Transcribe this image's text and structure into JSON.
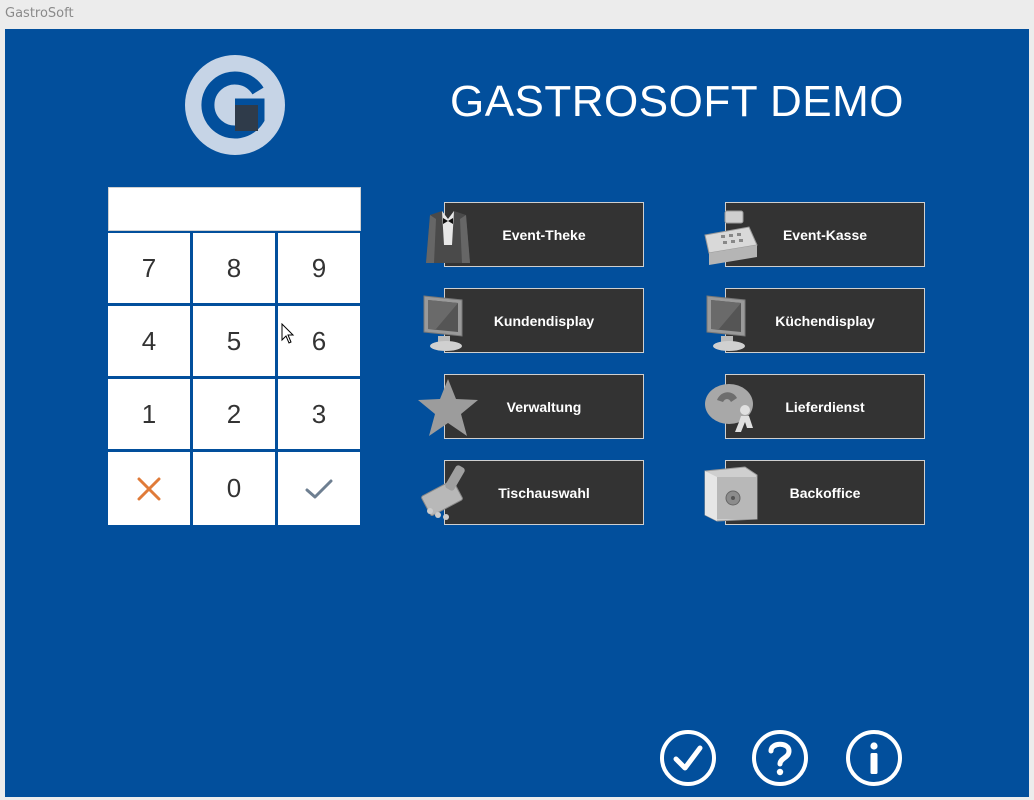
{
  "window": {
    "title": "GastroSoft"
  },
  "header": {
    "title": "GASTROSOFT DEMO"
  },
  "pin": {
    "value": ""
  },
  "keypad": {
    "keys": [
      {
        "label": "7"
      },
      {
        "label": "8"
      },
      {
        "label": "9"
      },
      {
        "label": "4"
      },
      {
        "label": "5"
      },
      {
        "label": "6"
      },
      {
        "label": "1"
      },
      {
        "label": "2"
      },
      {
        "label": "3"
      },
      {
        "icon": "cancel-icon"
      },
      {
        "label": "0"
      },
      {
        "icon": "confirm-icon"
      }
    ]
  },
  "functions": [
    {
      "label": "Event-Theke",
      "icon": "waiter-icon"
    },
    {
      "label": "Event-Kasse",
      "icon": "cash-register-icon"
    },
    {
      "label": "Kundendisplay",
      "icon": "monitor-icon"
    },
    {
      "label": "Küchendisplay",
      "icon": "monitor-icon"
    },
    {
      "label": "Verwaltung",
      "icon": "star-icon"
    },
    {
      "label": "Lieferdienst",
      "icon": "delivery-icon"
    },
    {
      "label": "Tischauswahl",
      "icon": "table-select-icon"
    },
    {
      "label": "Backoffice",
      "icon": "safe-icon"
    }
  ],
  "footer": {
    "buttons": [
      {
        "icon": "check-circle-icon"
      },
      {
        "icon": "help-circle-icon"
      },
      {
        "icon": "info-circle-icon"
      }
    ]
  },
  "colors": {
    "background": "#024f9c",
    "button": "#333333",
    "cancel": "#e07b39",
    "confirm": "#6e7f91"
  }
}
